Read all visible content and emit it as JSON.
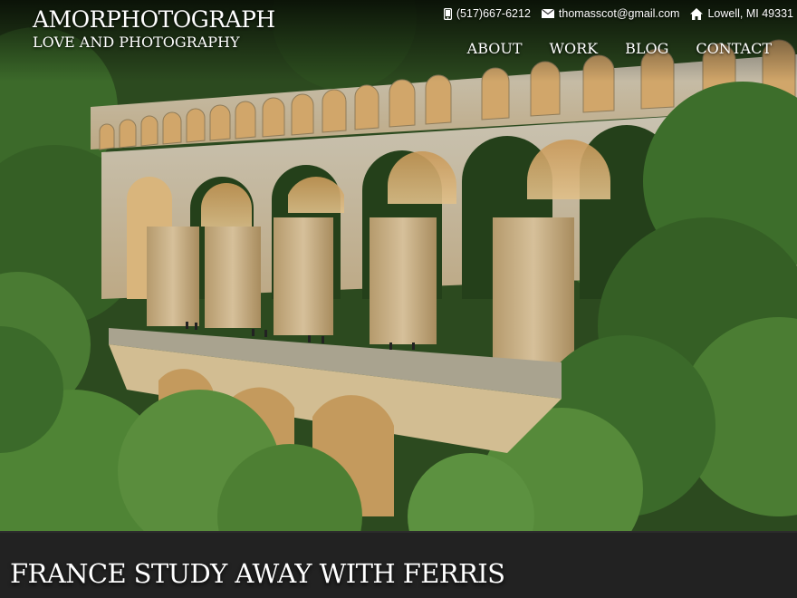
{
  "brand": {
    "title": "AMORPHOTOGRAPH",
    "tagline": "LOVE AND PHOTOGRAPHY"
  },
  "contact": {
    "phone": "(517)667-6212",
    "email": "thomasscot@gmail.com",
    "location": "Lowell, MI 49331",
    "icons": [
      "phone-icon",
      "envelope-icon",
      "home-icon"
    ]
  },
  "nav": {
    "items": [
      {
        "label": "ABOUT"
      },
      {
        "label": "WORK"
      },
      {
        "label": "BLOG"
      },
      {
        "label": "CONTACT"
      }
    ]
  },
  "hero": {
    "caption": "FRANCE STUDY AWAY WITH FERRIS"
  },
  "colors": {
    "caption_bar": "#222222",
    "text": "#ffffff",
    "stone": "#cbb58a",
    "foliage": "#3f6b2a"
  }
}
